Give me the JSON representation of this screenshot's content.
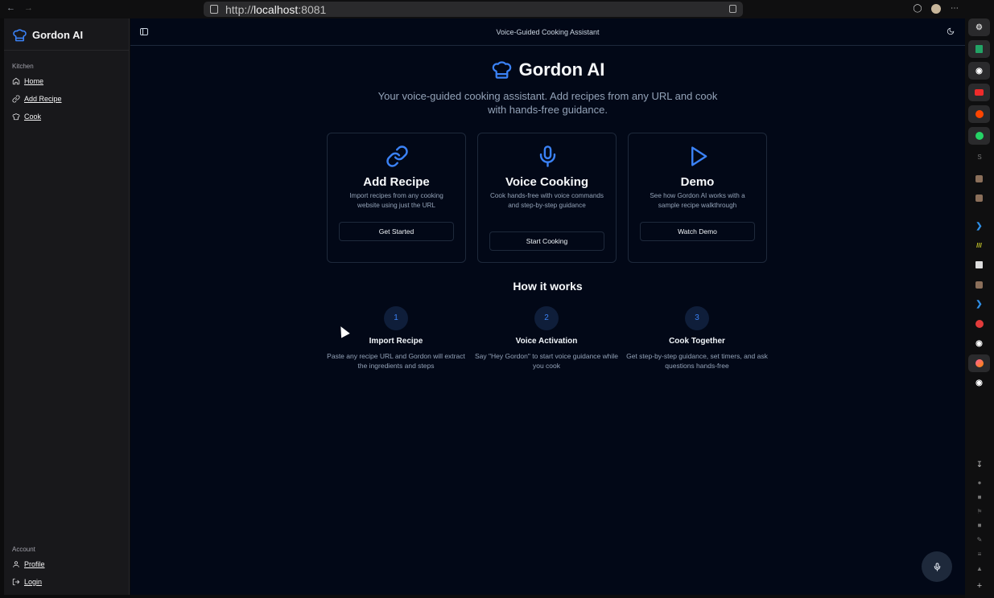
{
  "browser": {
    "url_prefix": "http://",
    "url_host": "localhost",
    "url_port": ":8081"
  },
  "sidebar": {
    "brand": "Gordon AI",
    "kitchen_label": "Kitchen",
    "kitchen_items": [
      {
        "label": "Home",
        "icon": "home-icon"
      },
      {
        "label": "Add Recipe",
        "icon": "link-icon"
      },
      {
        "label": "Cook",
        "icon": "chef-hat-icon"
      }
    ],
    "account_label": "Account",
    "account_items": [
      {
        "label": "Profile",
        "icon": "user-icon"
      },
      {
        "label": "Login",
        "icon": "login-icon"
      }
    ]
  },
  "header": {
    "title": "Voice-Guided Cooking Assistant"
  },
  "hero": {
    "title": "Gordon AI",
    "subtitle": "Your voice-guided cooking assistant. Add recipes from any URL and cook with hands-free guidance."
  },
  "cards": [
    {
      "title": "Add Recipe",
      "description": "Import recipes from any cooking website using just the URL",
      "button": "Get Started",
      "icon": "link-icon"
    },
    {
      "title": "Voice Cooking",
      "description": "Cook hands-free with voice commands and step-by-step guidance",
      "button": "Start Cooking",
      "icon": "microphone-icon"
    },
    {
      "title": "Demo",
      "description": "See how Gordon AI works with a sample recipe walkthrough",
      "button": "Watch Demo",
      "icon": "play-icon"
    }
  ],
  "how_it_works": {
    "title": "How it works",
    "steps": [
      {
        "number": "1",
        "title": "Import Recipe",
        "description": "Paste any recipe URL and Gordon will extract the ingredients and steps"
      },
      {
        "number": "2",
        "title": "Voice Activation",
        "description": "Say \"Hey Gordon\" to start voice guidance while you cook"
      },
      {
        "number": "3",
        "title": "Cook Together",
        "description": "Get step-by-step guidance, set timers, and ask questions hands-free"
      }
    ]
  },
  "right_rail": {
    "letter_s": "S",
    "icons": [
      "settings-icon",
      "sheets-icon",
      "github-icon",
      "youtube-icon",
      "reddit-icon",
      "whatsapp-icon",
      "vscode-icon",
      "tailwind-icon",
      "z-icon",
      "vscode-icon",
      "p-icon",
      "github-icon",
      "firefox-icon",
      "github-icon",
      "download-icon",
      "plus-icon"
    ]
  },
  "colors": {
    "accent": "#3b82f6",
    "background": "#020817",
    "sidebar": "#18181b",
    "border": "#1e293b"
  }
}
